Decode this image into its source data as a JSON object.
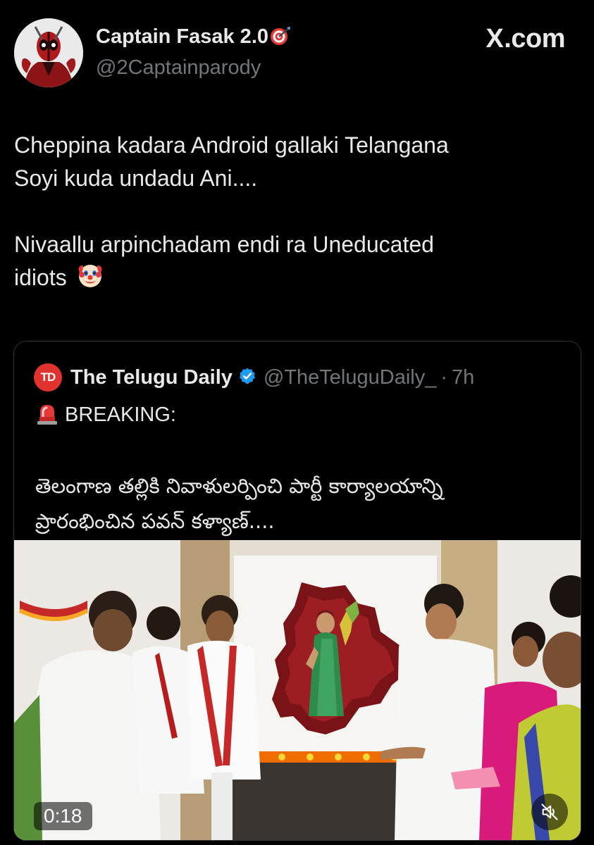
{
  "author": {
    "name": "Captain Fasak 2.0",
    "handle": "@2Captainparody",
    "avatar_icon": "deadpool-avatar",
    "badge_icon": "target-dart-icon"
  },
  "brand": {
    "x_mark": "X",
    "suffix": ".com"
  },
  "tweet": {
    "line1": "Cheppina kadara Android gallaki Telangana",
    "line2": "Soyi kuda undadu Ani....",
    "line3": "Nivaallu arpinchadam endi ra Uneducated",
    "line4": "idiots",
    "emoji_icon": "clown-face-icon"
  },
  "quote": {
    "logo_text": "TD",
    "name": "The Telugu Daily",
    "handle": "@TheTeluguDaily_",
    "separator": "·",
    "time": "7h",
    "breaking_label": "BREAKING:",
    "telugu_line1": "తెలంగాణ తల్లికి నివాళులర్పించి పార్టీ కార్యాలయాన్ని",
    "telugu_line2": "ప్రారంభించిన పవన్ కళ్యాణ్....",
    "verified_color": "#1d9bf0",
    "video": {
      "duration": "0:18",
      "mute_icon": "speaker-muted-icon"
    }
  },
  "colors": {
    "background": "#000000",
    "text_primary": "#e7e9ea",
    "text_secondary": "#71767b",
    "card_border": "#2f3336",
    "logo_red": "#e0332f"
  }
}
